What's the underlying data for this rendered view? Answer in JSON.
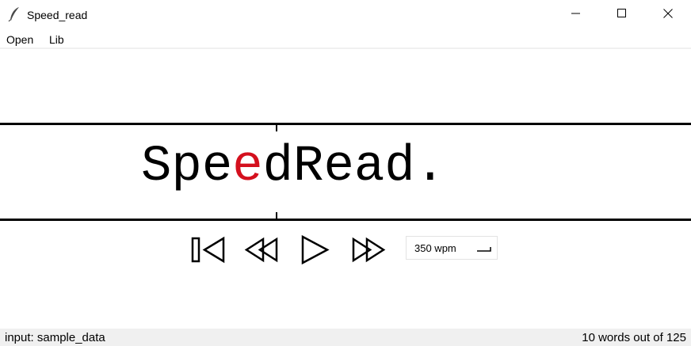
{
  "window": {
    "title": "Speed_read",
    "icon": "feather-icon"
  },
  "menu": {
    "open_label": "Open",
    "lib_label": "Lib"
  },
  "reader": {
    "word_prefix": "Spe",
    "word_focus": "e",
    "word_suffix": "dRead.",
    "focus_color": "#d4101e"
  },
  "controls": {
    "restart_icon": "skip-to-start-icon",
    "rewind_icon": "rewind-icon",
    "play_icon": "play-icon",
    "forward_icon": "fast-forward-icon",
    "speed_value": "350 wpm",
    "speed_icon": "enter-icon"
  },
  "status": {
    "input_text": "input: sample_data",
    "progress_text": "10 words out of 125"
  }
}
